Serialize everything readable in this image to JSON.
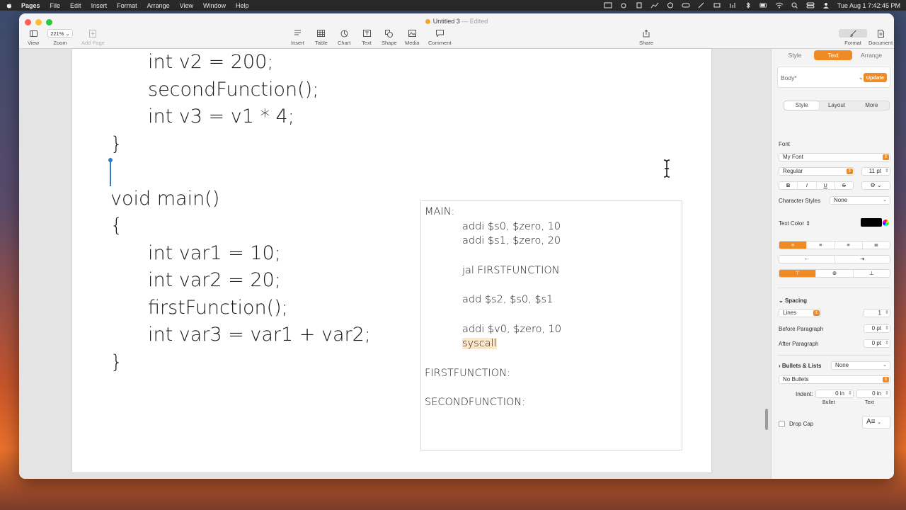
{
  "menubar": {
    "app": "Pages",
    "items": [
      "File",
      "Edit",
      "Insert",
      "Format",
      "Arrange",
      "View",
      "Window",
      "Help"
    ],
    "clock": "Tue Aug 1  7:42:45 PM"
  },
  "window": {
    "title": "Untitled 3",
    "edited": "— Edited"
  },
  "toolbar": {
    "view": "View",
    "zoom_value": "221%",
    "zoom": "Zoom",
    "add_page": "Add Page",
    "insert": "Insert",
    "table": "Table",
    "chart": "Chart",
    "text": "Text",
    "shape": "Shape",
    "media": "Media",
    "comment": "Comment",
    "share": "Share",
    "format": "Format",
    "document": "Document"
  },
  "document": {
    "code_lines": [
      {
        "text": "int v2 = 200;",
        "indent": true
      },
      {
        "text": "secondFunction();",
        "indent": true
      },
      {
        "text": "int v3 = v1 * 4;",
        "indent": true
      },
      {
        "text": "}",
        "indent": false
      },
      {
        "text": "",
        "indent": false
      },
      {
        "text": "void main()",
        "indent": false
      },
      {
        "text": "{",
        "indent": false
      },
      {
        "text": "int var1 = 10;",
        "indent": true
      },
      {
        "text": "int var2 = 20;",
        "indent": true
      },
      {
        "text": "firstFunction();",
        "indent": true
      },
      {
        "text": "int var3 = var1 + var2;",
        "indent": true
      },
      {
        "text": "}",
        "indent": false
      }
    ],
    "asm_lines": [
      {
        "text": "MAIN:",
        "indent": false
      },
      {
        "text": "addi $s0, $zero, 10",
        "indent": true
      },
      {
        "text": "addi $s1, $zero, 20",
        "indent": true
      },
      {
        "text": "",
        "indent": false
      },
      {
        "text": "jal FIRSTFUNCTION",
        "indent": true
      },
      {
        "text": "",
        "indent": false
      },
      {
        "text": "add $s2, $s0, $s1",
        "indent": true
      },
      {
        "text": "",
        "indent": false
      },
      {
        "text": "addi $v0, $zero, 10",
        "indent": true
      },
      {
        "text": "syscall",
        "indent": true,
        "highlight": true
      },
      {
        "text": "",
        "indent": false
      },
      {
        "text": "FIRSTFUNCTION:",
        "indent": false
      },
      {
        "text": "",
        "indent": false
      },
      {
        "text": "SECONDFUNCTION:",
        "indent": false
      }
    ]
  },
  "inspector": {
    "tabs": [
      "Style",
      "Text",
      "Arrange"
    ],
    "active_tab": "Text",
    "paragraph_style": "Body*",
    "update": "Update",
    "subtabs": [
      "Style",
      "Layout",
      "More"
    ],
    "font_heading": "Font",
    "font_name": "My Font",
    "font_weight": "Regular",
    "font_size": "11 pt",
    "style_buttons": [
      "B",
      "I",
      "U",
      "S"
    ],
    "character_styles_label": "Character Styles",
    "character_styles_value": "None",
    "text_color_label": "Text Color",
    "text_color": "#000000",
    "spacing_heading": "Spacing",
    "spacing_mode": "Lines",
    "spacing_value": "1",
    "before_paragraph_label": "Before Paragraph",
    "before_paragraph_value": "0 pt",
    "after_paragraph_label": "After Paragraph",
    "after_paragraph_value": "0 pt",
    "bullets_heading": "Bullets & Lists",
    "bullets_value": "None",
    "bullets_type": "No Bullets",
    "indent_label": "Indent:",
    "bullet_indent": "0 in",
    "text_indent": "0 in",
    "bullet_label": "Bullet",
    "text_label": "Text",
    "drop_cap": "Drop Cap"
  },
  "colors": {
    "accent": "#f08a24"
  }
}
